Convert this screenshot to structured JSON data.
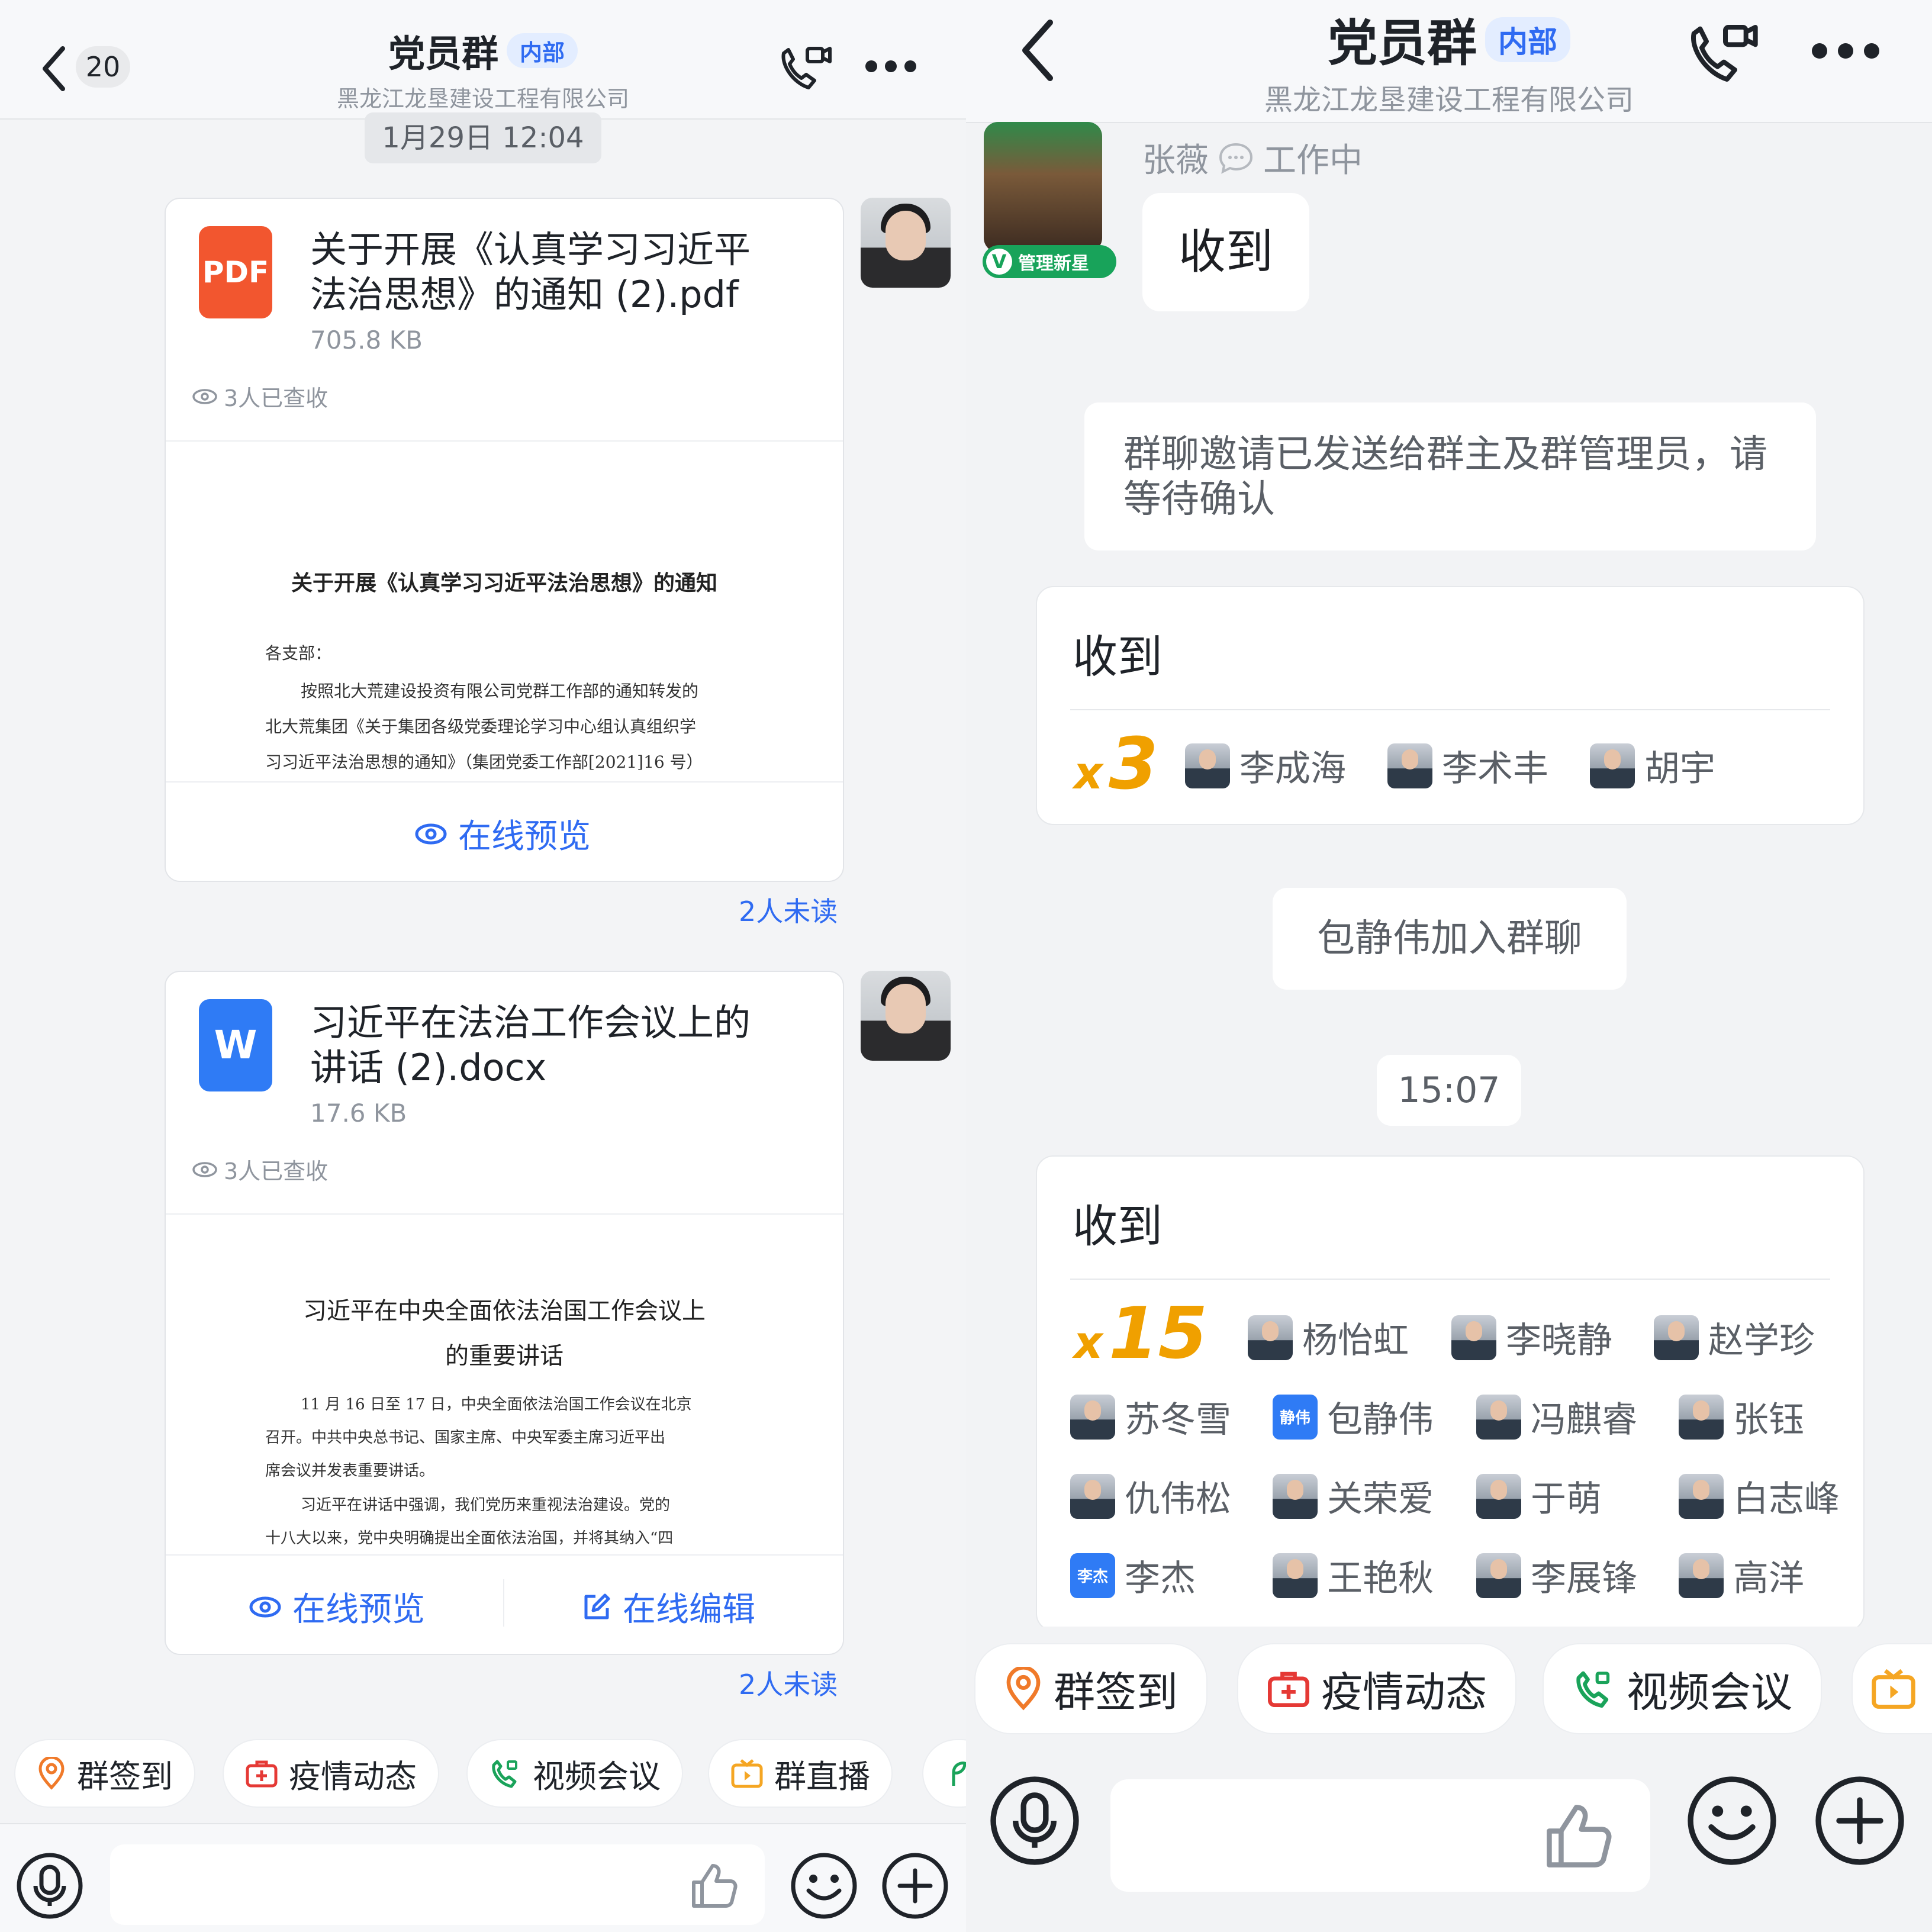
{
  "left": {
    "header": {
      "back_count": "20",
      "group_name": "党员群",
      "badge": "内部",
      "company": "黑龙江龙垦建设工程有限公司"
    },
    "timestamp": "1月29日 12:04",
    "files": [
      {
        "icon": "pdf-icon",
        "icon_label": "PDF",
        "name_line1": "关于开展《认真学习习近平",
        "name_line2": "法治思想》的通知 (2).pdf",
        "size": "705.8 KB",
        "viewed": "3人已查收",
        "preview": {
          "title": "关于开展《认真学习习近平法治思想》的通知",
          "lines": [
            "各支部：",
            "按照北大荒建设投资有限公司党群工作部的通知转发的",
            "北大荒集团《关于集团各级党委理论学习中心组认真组织学",
            "习习近平法治思想的通知》（集团党委工作部[2021]16 号）"
          ]
        },
        "actions": [
          "在线预览"
        ],
        "unread": "2人未读"
      },
      {
        "icon": "word-icon",
        "icon_label": "W",
        "name_line1": "习近平在法治工作会议上的",
        "name_line2": "讲话 (2).docx",
        "size": "17.6 KB",
        "viewed": "3人已查收",
        "preview": {
          "title_line1": "习近平在中央全面依法治国工作会议上",
          "title_line2": "的重要讲话",
          "lines": [
            "11 月 16 日至 17 日，中央全面依法治国工作会议在北京",
            "召开。中共中央总书记、国家主席、中央军委主席习近平出",
            "席会议并发表重要讲话。",
            "习近平在讲话中强调，我们党历来重视法治建设。党的",
            "十八大以来，党中央明确提出全面依法治国，并将其纳入“四"
          ]
        },
        "actions": [
          "在线预览",
          "在线编辑"
        ],
        "unread": "2人未读"
      }
    ],
    "quick_bar": [
      "群签到",
      "疫情动态",
      "视频会议",
      "群直播"
    ]
  },
  "right": {
    "header": {
      "group_name": "党员群",
      "badge": "内部",
      "company": "黑龙江龙垦建设工程有限公司"
    },
    "sender": {
      "name": "张薇",
      "status": "工作中",
      "avatar_badge": "管理新星",
      "avatar_badge_letter": "V",
      "message": "收到"
    },
    "system_invite": "群聊邀请已发送给群主及群管理员，请等待确认",
    "ack1": {
      "title": "收到",
      "count_prefix": "x",
      "count": "3",
      "members": [
        "李成海",
        "李术丰",
        "胡宇"
      ]
    },
    "join_notice": "包静伟加入群聊",
    "time": "15:07",
    "ack2": {
      "title": "收到",
      "count_prefix": "x",
      "count": "15",
      "members": [
        "杨怡虹",
        "李晓静",
        "赵学珍",
        "苏冬雪",
        "包静伟",
        "冯麒睿",
        "张钰",
        "仇伟松",
        "关荣爱",
        "于萌",
        "白志峰",
        "李杰",
        "王艳秋",
        "李展锋",
        "高洋"
      ],
      "text_avatars": {
        "包静伟": "静伟",
        "李杰": "李杰"
      }
    },
    "quick_bar": [
      "群签到",
      "疫情动态",
      "视频会议"
    ]
  },
  "colors": {
    "accent_blue": "#2f6bf2",
    "ack_orange": "#f0a000",
    "pdf_red": "#f2562f",
    "word_blue": "#2f7bf5"
  }
}
